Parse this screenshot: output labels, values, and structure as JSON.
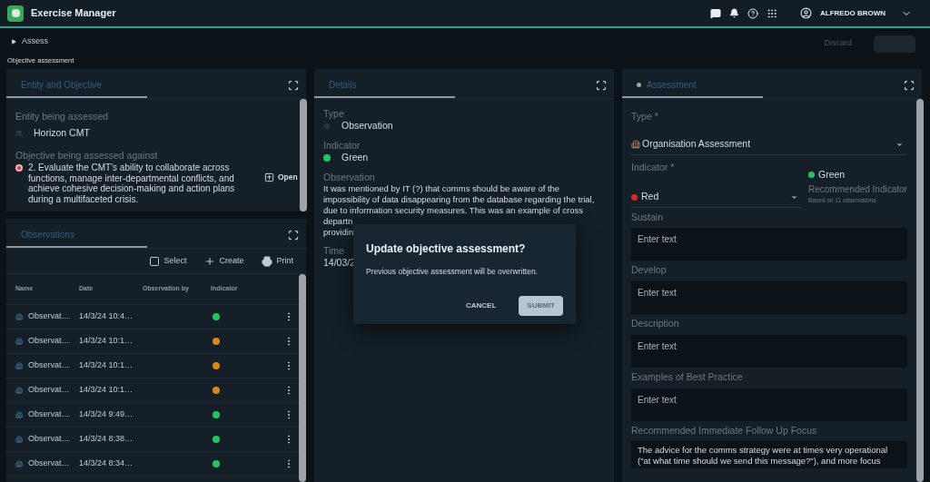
{
  "header": {
    "app_name": "Exercise Manager",
    "user_name": "ALFREDO BROWN"
  },
  "subheader": {
    "breadcrumb": "Assess",
    "page_title": "Objective assessment",
    "discard_label": "Discard"
  },
  "entity_panel": {
    "tab": {
      "label": "Entity and Objective",
      "selected": true
    },
    "entity_label": "Entity being assessed",
    "entity_value": "Horizon CMT",
    "objective_label": "Objective being assessed against",
    "objective_value": "2. Evaluate the CMT's ability to collaborate across functions, manage inter-departmental conflicts, and achieve cohesive decision-making and action plans during a multifaceted crisis.",
    "open_label": "Open"
  },
  "observations_panel": {
    "tab": {
      "label": "Observations",
      "selected": true
    },
    "toolbar": [
      {
        "kind": "select",
        "label": "Select",
        "checked": false
      },
      {
        "kind": "create",
        "label": "Create"
      },
      {
        "kind": "print",
        "label": "Print"
      }
    ],
    "columns": [
      "Name",
      "Date",
      "Observation by",
      "Indicator"
    ],
    "rows": [
      {
        "name": "Observat…",
        "date": "14/3/24 10:4…",
        "color": "#22c55e"
      },
      {
        "name": "Observat…",
        "date": "14/3/24 10:1…",
        "color": "#d9861f"
      },
      {
        "name": "Observat…",
        "date": "14/3/24 10:1…",
        "color": "#d9861f"
      },
      {
        "name": "Observat…",
        "date": "14/3/24 10:1…",
        "color": "#d9861f"
      },
      {
        "name": "Observat…",
        "date": "14/3/24 9:49…",
        "color": "#22c55e"
      },
      {
        "name": "Observat…",
        "date": "14/3/24 8:38…",
        "color": "#22c55e"
      },
      {
        "name": "Observat…",
        "date": "14/3/24 8:34…",
        "color": "#22c55e"
      }
    ]
  },
  "details_panel": {
    "tab": {
      "label": "Details",
      "selected": true
    },
    "type_label": "Type",
    "type_value": "Observation",
    "indicator_label": "Indicator",
    "indicator": {
      "value": "Green",
      "color": "#22c55e"
    },
    "observation_label": "Observation",
    "observation_lines": [
      "It was mentioned by IT (?) that comms should be aware of the",
      "impossibility of data disappearing from the database regarding the trial,",
      "due to information security measures. This was an example of cross",
      "departn",
      "providin"
    ],
    "time_label": "Time",
    "time_value": "14/03/2"
  },
  "assessment_panel": {
    "tab": {
      "label": "Assessment",
      "selected": true,
      "modified": true
    },
    "type_label": "Type *",
    "type_value": "Organisation Assessment",
    "indicator_label": "Indicator *",
    "indicator": {
      "value": "Red",
      "color": "#dc2626"
    },
    "recommended": {
      "value": "Green",
      "color": "#22c55e",
      "label": "Recommended Indicator",
      "note": "Based on 11 observations"
    },
    "fields": [
      {
        "label": "Sustain",
        "placeholder": "Enter text"
      },
      {
        "label": "Develop",
        "placeholder": "Enter text"
      },
      {
        "label": "Description",
        "placeholder": "Enter text"
      },
      {
        "label": "Examples of Best Practice",
        "placeholder": "Enter text"
      },
      {
        "label": "Recommended Immediate Follow Up Focus",
        "value": "The advice for the comms strategy were at times very operational (\"at what time should we send this message?\"), and more focus"
      }
    ]
  },
  "dialog": {
    "title": "Update objective assessment?",
    "message": "Previous objective assessment will be overwritten.",
    "buttons": [
      {
        "kind": "text",
        "label": "CANCEL"
      },
      {
        "kind": "primary",
        "label": "SUBMIT"
      }
    ]
  }
}
